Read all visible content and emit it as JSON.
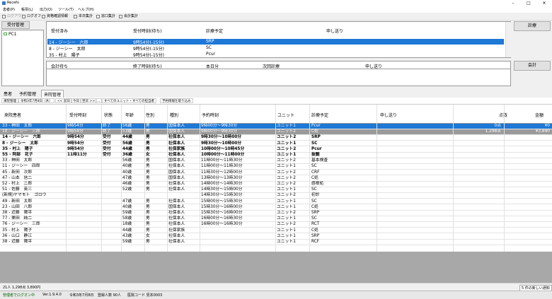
{
  "window": {
    "title": "Recefo",
    "minimize": "–",
    "maximize": "□",
    "close": "✕"
  },
  "menu": [
    "患者(P)",
    "帳票(L)",
    "出力(O)",
    "ツール(T)",
    "ヘルプ(H)"
  ],
  "toolbar": [
    "ログアウト",
    "ログオフ",
    "資格確認情報",
    "本日集計",
    "窓口集計",
    "会計集計"
  ],
  "left": {
    "reception_button": "受付管理",
    "pc_item": "PC1"
  },
  "right_buttons": {
    "exam": "診療",
    "accounting": "会計"
  },
  "upper_panel": {
    "headers": [
      "受付済み",
      "受付時刻(待ち)",
      "診療予定",
      "申し送り"
    ],
    "rows": [
      [
        "14 - ジーシー　六郎",
        "9時54分(-15分)",
        "SRP"
      ],
      [
        "8 - ジーシー　太郎",
        "9時54分(-15分)",
        "SC"
      ],
      [
        "35 - 村上　陽子",
        "9時54分(-15分)",
        "Pcur"
      ]
    ]
  },
  "lower_panel": {
    "headers": [
      "会計待ち",
      "終了時刻(待ち)",
      "本日分",
      "次回診療",
      "申し送り"
    ]
  },
  "tabs": [
    "患者",
    "予約管理",
    "来院管理"
  ],
  "navbar": [
    "来院管理",
    "令和3年7月8日（木）",
    "<< 前日",
    "今日",
    "翌日 >>",
    "...",
    "すべてのユニット・すべての担当者",
    "予約情報を取り込み"
  ],
  "grid": {
    "headers": [
      "来院患者",
      "受付時刻",
      "状態",
      "年齢",
      "性別",
      "種別",
      "予約時刻",
      "ユニット",
      "診療予定",
      "申し送り",
      "点数",
      "金額"
    ],
    "rows": [
      {
        "style": "sel1",
        "cells": [
          "33 - 神田　太郎",
          "9時54分",
          "終了",
          "56歳",
          "男",
          "国保本人",
          "9時00分～9時30分",
          "ユニット1",
          "Pcur",
          "",
          "0点",
          "¥0"
        ]
      },
      {
        "style": "sel2",
        "cells": [
          "10 - ジーシー　三郎",
          "9時54分",
          "終了",
          "53歳",
          "男",
          "国保本人",
          "9時00分～9時30分",
          "ユニット2",
          "C処",
          "",
          "1,298点",
          "¥3,890"
        ]
      },
      {
        "style": "bold",
        "cells": [
          "14 - ジーシー　六郎",
          "9時54分",
          "受付",
          "44歳",
          "男",
          "社保本人",
          "9時30分～10時00分",
          "ユニット2",
          "SRP",
          "",
          "",
          ""
        ]
      },
      {
        "style": "bold",
        "cells": [
          "8 - ジーシー　太郎",
          "9時54分",
          "受付",
          "56歳",
          "男",
          "社保本人",
          "9時30分～10時00分",
          "ユニット1",
          "SC",
          "",
          "",
          ""
        ]
      },
      {
        "style": "bold",
        "cells": [
          "35 - 村上　陽子",
          "9時54分",
          "受付",
          "44歳",
          "男",
          "社保家族",
          "10時00分～10時45分",
          "ユニット2",
          "Pcur",
          "",
          "",
          ""
        ]
      },
      {
        "style": "bold",
        "cells": [
          "55 - 阿部　花子",
          "11時11分",
          "受付",
          "36歳",
          "女",
          "社保本人",
          "10時00分～11時00分",
          "ユニット1",
          "抜髄",
          "",
          "",
          ""
        ]
      },
      {
        "style": "",
        "cells": [
          "33 - 神田　太郎",
          "",
          "",
          "56歳",
          "男",
          "国保本人",
          "11時00分～11時30分",
          "ユニット2",
          "基本検査",
          "",
          "",
          ""
        ]
      },
      {
        "style": "",
        "cells": [
          "11 - ジーシー　四郎",
          "",
          "",
          "40歳",
          "男",
          "社保本人",
          "11時00分～11時30分",
          "ユニット1",
          "SC",
          "",
          "",
          ""
        ]
      },
      {
        "style": "",
        "cells": [
          "45 - 新田　次郎",
          "",
          "",
          "40歳",
          "男",
          "国保本人",
          "11時30分～12時00分",
          "ユニット2",
          "CRF",
          "",
          "",
          ""
        ]
      },
      {
        "style": "",
        "cells": [
          "47 - 山本　信二",
          "",
          "",
          "47歳",
          "男",
          "国保本人",
          "13時00分～13時30分",
          "ユニット2",
          "C処",
          "",
          "",
          ""
        ]
      },
      {
        "style": "",
        "cells": [
          "52 - 村上　二郎",
          "",
          "",
          "46歳",
          "男",
          "社保本人",
          "14時00分～14時30分",
          "ユニット2",
          "感根処",
          "",
          "",
          ""
        ]
      },
      {
        "style": "",
        "cells": [
          "51 - 佐藤　英三",
          "",
          "",
          "52歳",
          "男",
          "社保本人",
          "14時30分～15時00分",
          "ユニット1",
          "SC",
          "",
          "",
          ""
        ]
      },
      {
        "style": "",
        "cells": [
          "(新規)ヤマモト　ゴロウ",
          "",
          "",
          "",
          "",
          "",
          "14時30分～15時30分",
          "ユニット2",
          "初診",
          "",
          "",
          ""
        ]
      },
      {
        "style": "",
        "cells": [
          "49 - 新田　太郎",
          "",
          "",
          "47歳",
          "男",
          "社保本人",
          "15時00分～15時30分",
          "ユニット1",
          "SC",
          "",
          "",
          ""
        ]
      },
      {
        "style": "",
        "cells": [
          "23 - 山田　八郎",
          "",
          "",
          "40歳",
          "男",
          "国保本人",
          "15時30分～16時00分",
          "ユニット1",
          "C処",
          "",
          "",
          ""
        ]
      },
      {
        "style": "",
        "cells": [
          "38 - 近藤　陽平",
          "",
          "",
          "59歳",
          "男",
          "社保本人",
          "15時30分～16時00分",
          "ユニット2",
          "SRP",
          "",
          "",
          ""
        ]
      },
      {
        "style": "",
        "cells": [
          "77 - 栗田　純二",
          "",
          "",
          "58歳",
          "男",
          "社保本人",
          "16時00分～16時30分",
          "ユニット1",
          "SC",
          "",
          "",
          ""
        ]
      },
      {
        "style": "",
        "cells": [
          "76 - ジーシー　三郎",
          "",
          "",
          "18歳",
          "男",
          "社保本人",
          "16時00分～16時30分",
          "ユニット2",
          "RCT",
          "",
          "",
          ""
        ]
      },
      {
        "style": "",
        "cells": [
          "35 - 村上　陽子",
          "",
          "",
          "44歳",
          "男",
          "社保家族",
          "",
          "ユニット1",
          "C処",
          "",
          "",
          ""
        ]
      },
      {
        "style": "",
        "cells": [
          "36 - 山口　静江",
          "",
          "",
          "43歳",
          "女",
          "社保本人",
          "",
          "ユニット1",
          "SRP",
          "",
          "",
          ""
        ]
      },
      {
        "style": "",
        "cells": [
          "38 - 近藤　陽平",
          "",
          "",
          "59歳",
          "男",
          "社保本人",
          "",
          "ユニット1",
          "RCF",
          "",
          "",
          ""
        ]
      }
    ]
  },
  "status": {
    "summary": "21人 1,298点 3,890円",
    "right": "5 件の新しい通知"
  },
  "bottom": {
    "login": "管理者でログオン中",
    "version": "Ver.1.9.4.0",
    "date": "令和3年7月8日",
    "info": "登録人数 90人",
    "code": "医院コード 見本0003"
  }
}
